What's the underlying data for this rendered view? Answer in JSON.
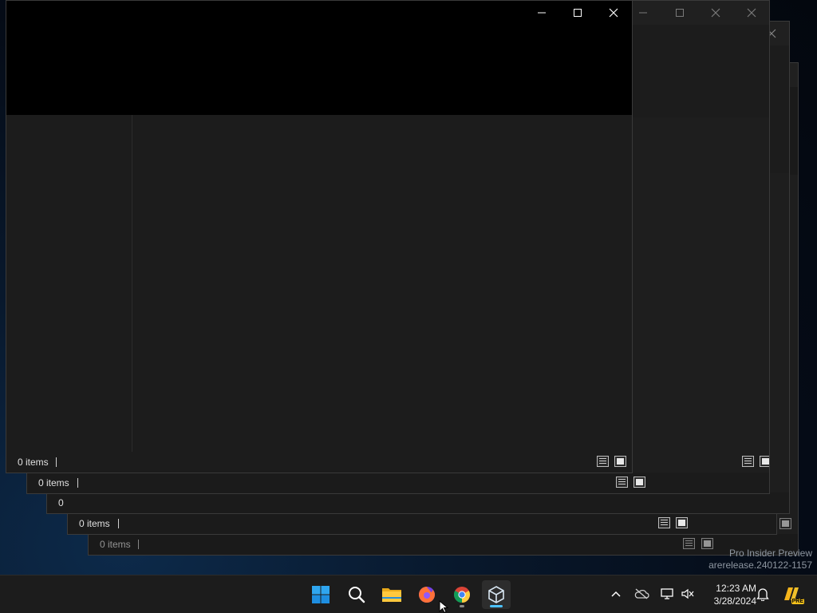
{
  "desktop": {
    "watermark_line1": "Pro Insider Preview",
    "watermark_line2": "arerelease.240122-1157"
  },
  "windows": [
    {
      "id": "w1",
      "status": "0 items"
    },
    {
      "id": "w2",
      "status": "0 items"
    },
    {
      "id": "w3",
      "status": "0"
    },
    {
      "id": "w4",
      "status": "0 items"
    },
    {
      "id": "w5",
      "status": "0 items"
    }
  ],
  "taskbar": {
    "apps": [
      {
        "name": "Start",
        "icon": "windows-start-icon"
      },
      {
        "name": "Search",
        "icon": "search-icon"
      },
      {
        "name": "File Explorer",
        "icon": "folder-icon"
      },
      {
        "name": "Firefox",
        "icon": "firefox-icon"
      },
      {
        "name": "Google Chrome",
        "icon": "chrome-icon"
      },
      {
        "name": "VirtualBox",
        "icon": "virtualbox-cube-icon"
      }
    ],
    "tray": [
      "chevron-up-icon",
      "onedrive-offline-icon",
      "network-icon",
      "volume-muted-icon",
      "notification-bell-icon",
      "copilot-pre-icon"
    ],
    "clock_time": "12:23 AM",
    "clock_date": "3/28/2024",
    "copilot_badge": "PRE"
  },
  "colors": {
    "window_bg": "#1e1e1e",
    "titlebar_black": "#000000",
    "taskbar_bg": "#1c1c1c",
    "accent": "#4cc2ff"
  }
}
